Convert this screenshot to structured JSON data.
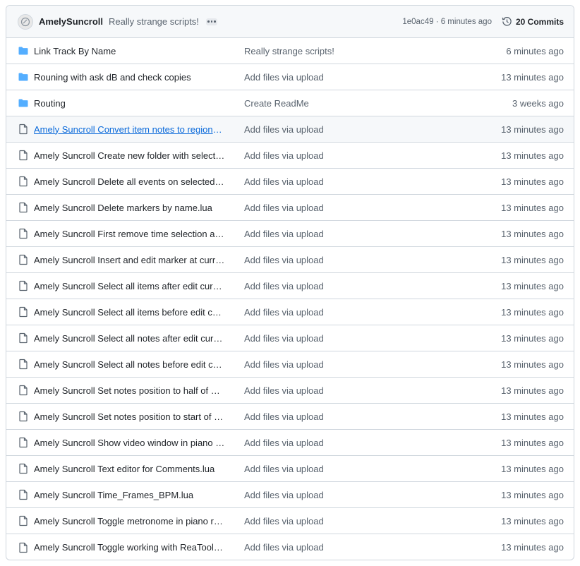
{
  "header": {
    "author": "AmelySuncroll",
    "message": "Really strange scripts!",
    "hash_time": "1e0ac49 · 6 minutes ago",
    "commits": "20 Commits"
  },
  "colors": {
    "folder": "#54aeff",
    "file_icon": "#59636e",
    "link": "#0969da"
  },
  "files": [
    {
      "type": "folder",
      "name": "Link Track By Name",
      "message": "Really strange scripts!",
      "age": "6 minutes ago"
    },
    {
      "type": "folder",
      "name": "Rouning with ask dB and check copies",
      "message": "Add files via upload",
      "age": "13 minutes ago"
    },
    {
      "type": "folder",
      "name": "Routing",
      "message": "Create ReadMe",
      "age": "3 weeks ago"
    },
    {
      "type": "file",
      "name": "Amely Suncroll Convert item notes to regions.lua",
      "message": "Add files via upload",
      "age": "13 minutes ago",
      "highlight": true
    },
    {
      "type": "file",
      "name": "Amely Suncroll Create new folder with selected items.lua",
      "message": "Add files via upload",
      "age": "13 minutes ago"
    },
    {
      "type": "file",
      "name": "Amely Suncroll Delete all events on selected midi items.lua",
      "message": "Add files via upload",
      "age": "13 minutes ago"
    },
    {
      "type": "file",
      "name": "Amely Suncroll Delete markers by name.lua",
      "message": "Add files via upload",
      "age": "13 minutes ago"
    },
    {
      "type": "file",
      "name": "Amely Suncroll First remove time selection and then items.lua",
      "message": "Add files via upload",
      "age": "13 minutes ago"
    },
    {
      "type": "file",
      "name": "Amely Suncroll Insert and edit marker at current position.lua",
      "message": "Add files via upload",
      "age": "13 minutes ago"
    },
    {
      "type": "file",
      "name": "Amely Suncroll Select all items after edit cursor.lua",
      "message": "Add files via upload",
      "age": "13 minutes ago"
    },
    {
      "type": "file",
      "name": "Amely Suncroll Select all items before edit cursor.lua",
      "message": "Add files via upload",
      "age": "13 minutes ago"
    },
    {
      "type": "file",
      "name": "Amely Suncroll Select all notes after edit cursor.lua",
      "message": "Add files via upload",
      "age": "13 minutes ago"
    },
    {
      "type": "file",
      "name": "Amely Suncroll Select all notes before edit cursor.lua",
      "message": "Add files via upload",
      "age": "13 minutes ago"
    },
    {
      "type": "file",
      "name": "Amely Suncroll Set notes position to half of measure.lua",
      "message": "Add files via upload",
      "age": "13 minutes ago"
    },
    {
      "type": "file",
      "name": "Amely Suncroll Set notes position to start of measure.lua",
      "message": "Add files via upload",
      "age": "13 minutes ago"
    },
    {
      "type": "file",
      "name": "Amely Suncroll Show video window in piano roll.lua",
      "message": "Add files via upload",
      "age": "13 minutes ago"
    },
    {
      "type": "file",
      "name": "Amely Suncroll Text editor for Comments.lua",
      "message": "Add files via upload",
      "age": "13 minutes ago"
    },
    {
      "type": "file",
      "name": "Amely Suncroll Time_Frames_BPM.lua",
      "message": "Add files via upload",
      "age": "13 minutes ago"
    },
    {
      "type": "file",
      "name": "Amely Suncroll Toggle metronome in piano roll.lua",
      "message": "Add files via upload",
      "age": "13 minutes ago"
    },
    {
      "type": "file",
      "name": "Amely Suncroll Toggle working with ReaTooled.lua",
      "message": "Add files via upload",
      "age": "13 minutes ago"
    }
  ]
}
